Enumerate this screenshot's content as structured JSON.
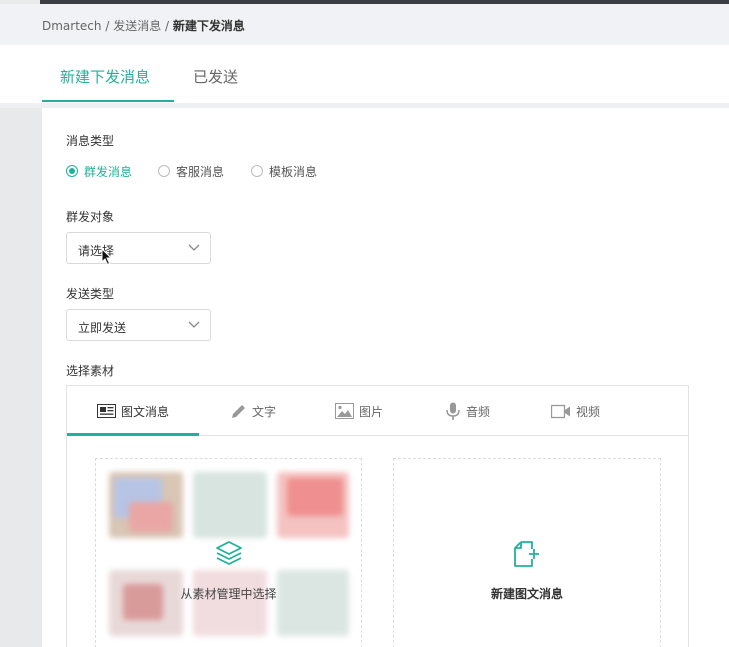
{
  "breadcrumb": {
    "root": "Dmartech",
    "sep1": " / ",
    "mid": "发送消息",
    "sep2": " / ",
    "current": "新建下发消息"
  },
  "tabs": [
    {
      "label": "新建下发消息",
      "active": true
    },
    {
      "label": "已发送",
      "active": false
    }
  ],
  "form": {
    "msg_type_label": "消息类型",
    "msg_type_options": [
      {
        "label": "群发消息",
        "selected": true
      },
      {
        "label": "客服消息",
        "selected": false
      },
      {
        "label": "模板消息",
        "selected": false
      }
    ],
    "target_label": "群发对象",
    "target_value": "请选择",
    "send_type_label": "发送类型",
    "send_type_value": "立即发送",
    "material_label": "选择素材"
  },
  "material": {
    "tabs": [
      {
        "label": "图文消息",
        "icon": "news-icon",
        "active": true
      },
      {
        "label": "文字",
        "icon": "pencil-icon",
        "active": false
      },
      {
        "label": "图片",
        "icon": "image-icon",
        "active": false
      },
      {
        "label": "音频",
        "icon": "microphone-icon",
        "active": false
      },
      {
        "label": "视频",
        "icon": "video-icon",
        "active": false
      }
    ],
    "choose_label": "从素材管理中选择",
    "new_label": "新建图文消息"
  },
  "colors": {
    "accent": "#1fb29a",
    "text": "#333333",
    "muted": "#666666",
    "border": "#d9d9d9"
  }
}
